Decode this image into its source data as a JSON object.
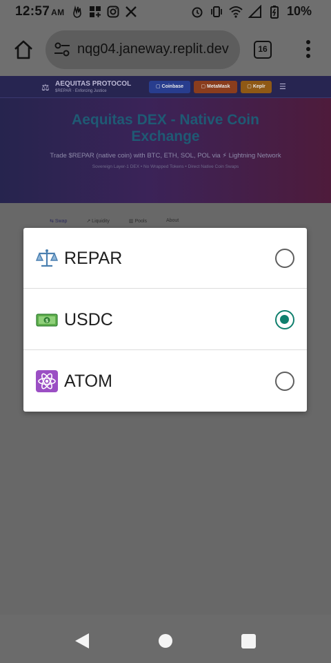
{
  "status_bar": {
    "time": "12:57",
    "ampm": "AM",
    "battery": "10%"
  },
  "browser": {
    "url": "nqg04.janeway.replit.dev",
    "tab_count": "16"
  },
  "site": {
    "brand_name": "AEQUITAS PROTOCOL",
    "brand_tagline": "$REPAR · Enforcing Justice",
    "wallets": [
      "Coinbase",
      "MetaMask",
      "Keplr"
    ],
    "hero_title": "Aequitas DEX - Native Coin Exchange",
    "hero_subtitle": "Trade $REPAR (native coin) with BTC, ETH, SOL, POL via ⚡ Lightning Network",
    "hero_subtitle2": "Sovereign Layer-1 DEX • No Wrapped Tokens • Direct Native Coin Swaps",
    "tabs": [
      {
        "icon": "⇆",
        "label": "Swap"
      },
      {
        "icon": "↗",
        "label": "Liquidity"
      },
      {
        "icon": "▥",
        "label": "Pools"
      },
      {
        "icon": "",
        "label": "About"
      }
    ]
  },
  "dialog": {
    "options": [
      {
        "emoji": "scales-icon",
        "label": "REPAR",
        "selected": false
      },
      {
        "emoji": "money-icon",
        "label": "USDC",
        "selected": true
      },
      {
        "emoji": "atom-icon",
        "label": "ATOM",
        "selected": false
      }
    ]
  },
  "colors": {
    "radio_selected": "#0f7f6d",
    "scrim": "#6b6b6b"
  }
}
